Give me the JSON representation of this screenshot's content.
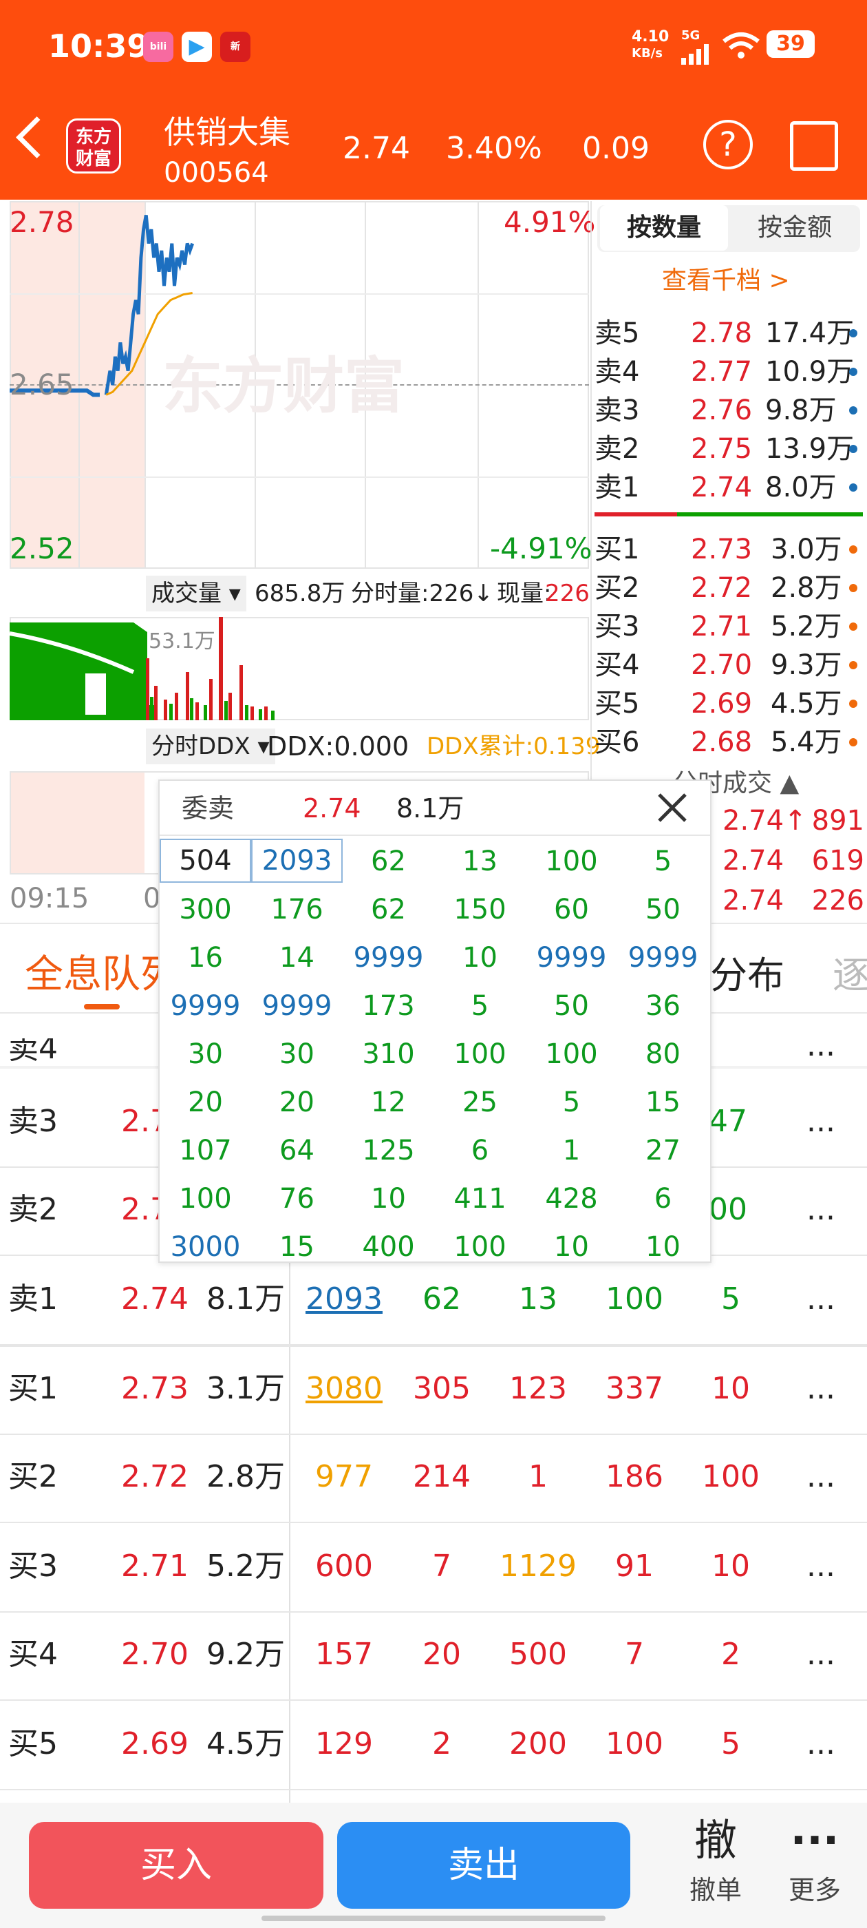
{
  "status": {
    "time": "10:39",
    "net_speed_top": "4.10",
    "net_speed_bot": "KB/s",
    "signal": "5G",
    "battery": "39"
  },
  "header": {
    "logo_line1": "东方",
    "logo_line2": "财富",
    "name": "供销大集",
    "code": "000564",
    "price": "2.74",
    "change_pct": "3.40%",
    "change": "0.09",
    "help": "?"
  },
  "chart": {
    "price_high": "2.78",
    "price_mid": "2.65",
    "price_low": "2.52",
    "pct_high": "4.91%",
    "pct_low": "-4.91%",
    "watermark": "东方财富",
    "vol_selector": "成交量",
    "vol_total": "685.8万",
    "vol_minute": "分时量:226↓",
    "vol_now_label": "现量:",
    "vol_now": "226",
    "vol_max": "53.1万",
    "ddx_selector": "分时DDX",
    "ddx": "DDX:0.000",
    "ddx_acc": "DDX累计:0.139",
    "time_start": "09:15",
    "time_next": "0",
    "chart_data": {
      "type": "line",
      "ylim": [
        2.52,
        2.78
      ],
      "series": [
        {
          "x": [
            0,
            5,
            10,
            15,
            20,
            25,
            30,
            35,
            40,
            45,
            50,
            55,
            60,
            65,
            70
          ],
          "values": [
            2.646,
            2.646,
            2.646,
            2.646,
            2.646,
            2.646,
            2.646,
            2.646,
            2.646,
            2.646,
            2.646,
            2.646,
            2.646,
            2.643,
            2.643
          ]
        },
        {
          "x": [
            75,
            78,
            80,
            82,
            84,
            86,
            88,
            90,
            92,
            94,
            96,
            98,
            100,
            102,
            104,
            106,
            108,
            110,
            112,
            114,
            116,
            118,
            120,
            122,
            124,
            126,
            128,
            130,
            132,
            134,
            136,
            138,
            140,
            142
          ],
          "values": [
            2.643,
            2.66,
            2.65,
            2.67,
            2.66,
            2.68,
            2.665,
            2.67,
            2.66,
            2.68,
            2.7,
            2.71,
            2.7,
            2.74,
            2.76,
            2.77,
            2.75,
            2.76,
            2.74,
            2.75,
            2.73,
            2.745,
            2.72,
            2.74,
            2.73,
            2.75,
            2.72,
            2.74,
            2.735,
            2.745,
            2.735,
            2.75,
            2.745,
            2.75
          ]
        },
        {
          "x": [
            75,
            80,
            85,
            90,
            95,
            100,
            105,
            110,
            115,
            120,
            125,
            130,
            135,
            142
          ],
          "values": [
            2.643,
            2.645,
            2.65,
            2.655,
            2.66,
            2.67,
            2.68,
            2.69,
            2.7,
            2.705,
            2.71,
            2.712,
            2.714,
            2.715
          ]
        }
      ]
    }
  },
  "side": {
    "tab_qty": "按数量",
    "tab_amt": "按金额",
    "view_more": "查看千档 >",
    "sells": [
      {
        "label": "卖5",
        "price": "2.78",
        "vol": "17.4万"
      },
      {
        "label": "卖4",
        "price": "2.77",
        "vol": "10.9万"
      },
      {
        "label": "卖3",
        "price": "2.76",
        "vol": "9.8万"
      },
      {
        "label": "卖2",
        "price": "2.75",
        "vol": "13.9万"
      },
      {
        "label": "卖1",
        "price": "2.74",
        "vol": "8.0万"
      }
    ],
    "buys": [
      {
        "label": "买1",
        "price": "2.73",
        "vol": "3.0万"
      },
      {
        "label": "买2",
        "price": "2.72",
        "vol": "2.8万"
      },
      {
        "label": "买3",
        "price": "2.71",
        "vol": "5.2万"
      },
      {
        "label": "买4",
        "price": "2.70",
        "vol": "9.3万"
      },
      {
        "label": "买5",
        "price": "2.69",
        "vol": "4.5万"
      },
      {
        "label": "买6",
        "price": "2.68",
        "vol": "5.4万"
      }
    ],
    "trades_title": "分时成交",
    "trades": [
      {
        "price": "2.74↑",
        "vol": "891"
      },
      {
        "price": "2.74",
        "vol": "619"
      },
      {
        "price": "2.74",
        "vol": "226"
      }
    ]
  },
  "tabs": {
    "queue": "全息队列",
    "dist": "分布",
    "next": "逐"
  },
  "popup": {
    "title": "委卖",
    "price": "2.74",
    "vol": "8.1万",
    "rows": [
      [
        "504",
        "2093",
        "62",
        "13",
        "100",
        "5"
      ],
      [
        "300",
        "176",
        "62",
        "150",
        "60",
        "50"
      ],
      [
        "16",
        "14",
        "9999",
        "10",
        "9999",
        "9999"
      ],
      [
        "9999",
        "9999",
        "173",
        "5",
        "50",
        "36"
      ],
      [
        "30",
        "30",
        "310",
        "100",
        "100",
        "80"
      ],
      [
        "20",
        "20",
        "12",
        "25",
        "5",
        "15"
      ],
      [
        "107",
        "64",
        "125",
        "6",
        "1",
        "27"
      ],
      [
        "100",
        "76",
        "10",
        "411",
        "428",
        "6"
      ],
      [
        "3000",
        "15",
        "400",
        "100",
        "10",
        "10"
      ]
    ]
  },
  "queue_table": {
    "partial_right": [
      "47",
      "00"
    ],
    "rows": [
      {
        "label": "卖3",
        "price": "2.7",
        "vol": ""
      },
      {
        "label": "卖2",
        "price": "2.7",
        "vol": ""
      },
      {
        "label": "卖1",
        "price": "2.74",
        "vol": "8.1万",
        "c": [
          "2093",
          "62",
          "13",
          "100",
          "5"
        ]
      },
      {
        "label": "买1",
        "price": "2.73",
        "vol": "3.1万",
        "c": [
          "3080",
          "305",
          "123",
          "337",
          "10"
        ]
      },
      {
        "label": "买2",
        "price": "2.72",
        "vol": "2.8万",
        "c": [
          "977",
          "214",
          "1",
          "186",
          "100"
        ]
      },
      {
        "label": "买3",
        "price": "2.71",
        "vol": "5.2万",
        "c": [
          "600",
          "7",
          "1129",
          "91",
          "10"
        ]
      },
      {
        "label": "买4",
        "price": "2.70",
        "vol": "9.2万",
        "c": [
          "157",
          "20",
          "500",
          "7",
          "2"
        ]
      },
      {
        "label": "买5",
        "price": "2.69",
        "vol": "4.5万",
        "c": [
          "129",
          "2",
          "200",
          "100",
          "5"
        ]
      }
    ],
    "more": "..."
  },
  "bottom": {
    "buy": "买入",
    "sell": "卖出",
    "cancel_icon_text": "撤",
    "cancel": "撤单",
    "more_icon_text": "···",
    "more": "更多"
  }
}
